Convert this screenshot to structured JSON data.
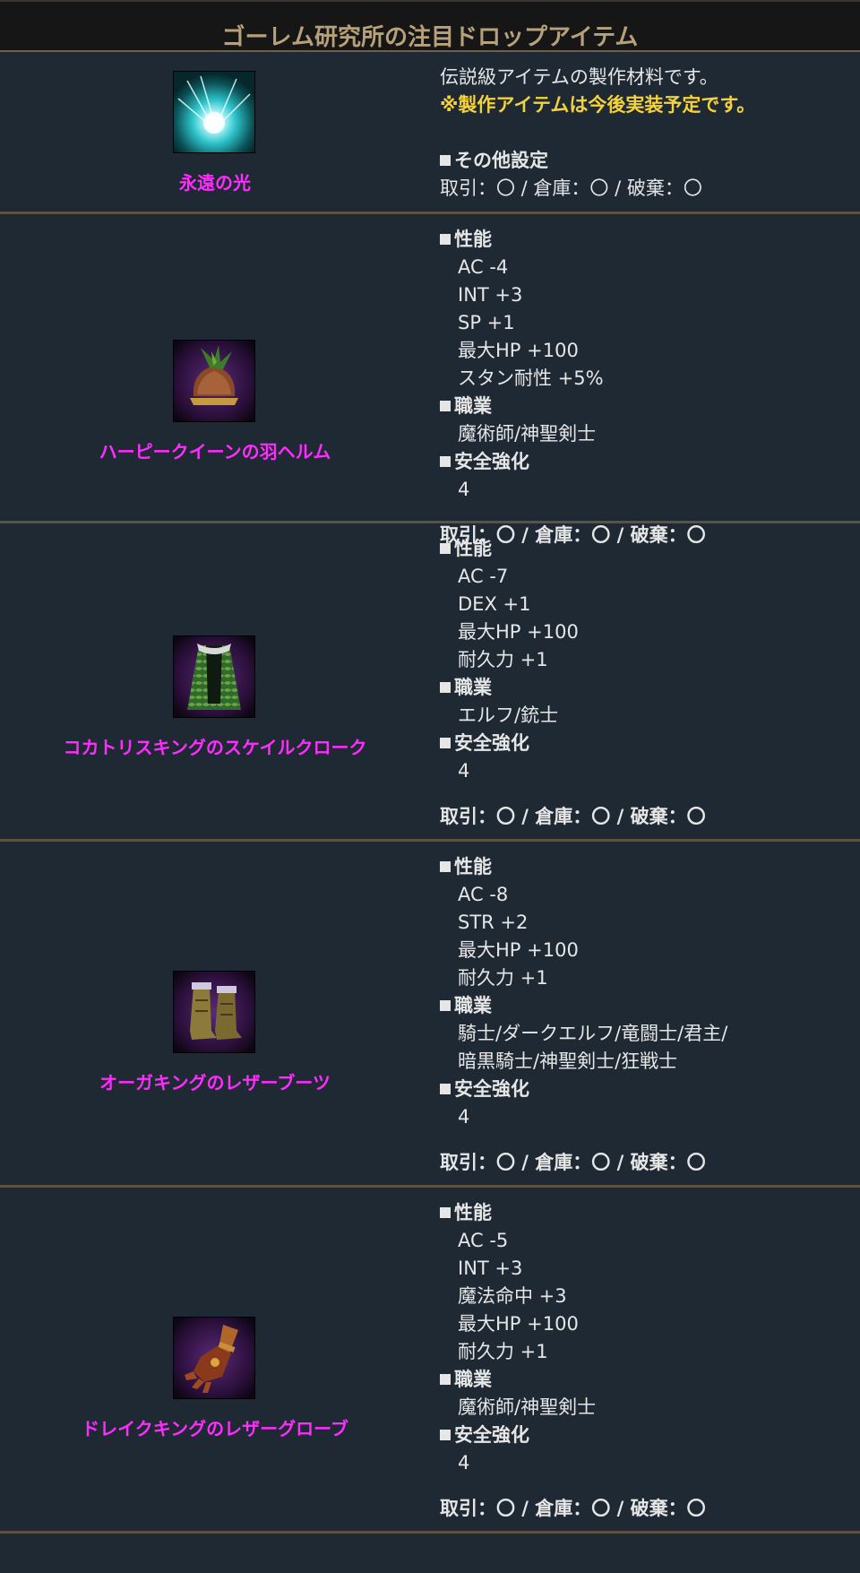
{
  "header": {
    "title": "ゴーレム研究所の注目ドロップアイテム"
  },
  "items": [
    {
      "name": "永遠の光",
      "icon": "light-orb-icon",
      "description": "伝説級アイテムの製作材料です。",
      "note": "※製作アイテムは今後実装予定です。",
      "other_settings_label": "その他設定",
      "trade": "取引：〇 / 倉庫：〇 / 破棄：〇"
    },
    {
      "name": "ハーピークイーンの羽ヘルム",
      "icon": "feather-helm-icon",
      "performance_label": "性能",
      "stats": [
        "AC -4",
        "INT +3",
        "SP +1",
        "最大HP +100",
        "スタン耐性 +5%"
      ],
      "class_label": "職業",
      "classes": [
        "魔術師/神聖剣士"
      ],
      "safe_label": "安全強化",
      "safe_value": "4",
      "trade": "取引：〇 / 倉庫：〇 / 破棄：〇"
    },
    {
      "name": "コカトリスキングのスケイルクローク",
      "icon": "scale-cloak-icon",
      "performance_label": "性能",
      "stats": [
        "AC -7",
        "DEX +1",
        "最大HP +100",
        "耐久力 +1"
      ],
      "class_label": "職業",
      "classes": [
        "エルフ/銃士"
      ],
      "safe_label": "安全強化",
      "safe_value": "4",
      "trade": "取引：〇 / 倉庫：〇 / 破棄：〇"
    },
    {
      "name": "オーガキングのレザーブーツ",
      "icon": "leather-boots-icon",
      "performance_label": "性能",
      "stats": [
        "AC -8",
        "STR +2",
        "最大HP +100",
        "耐久力 +1"
      ],
      "class_label": "職業",
      "classes": [
        "騎士/ダークエルフ/竜闘士/君主/",
        "暗黒騎士/神聖剣士/狂戦士"
      ],
      "safe_label": "安全強化",
      "safe_value": "4",
      "trade": "取引：〇 / 倉庫：〇 / 破棄：〇"
    },
    {
      "name": "ドレイクキングのレザーグローブ",
      "icon": "leather-glove-icon",
      "performance_label": "性能",
      "stats": [
        "AC -5",
        "INT +3",
        "魔法命中 +3",
        "最大HP +100",
        "耐久力 +1"
      ],
      "class_label": "職業",
      "classes": [
        "魔術師/神聖剣士"
      ],
      "safe_label": "安全強化",
      "safe_value": "4",
      "trade": "取引：〇 / 倉庫：〇 / 破棄：〇"
    }
  ]
}
